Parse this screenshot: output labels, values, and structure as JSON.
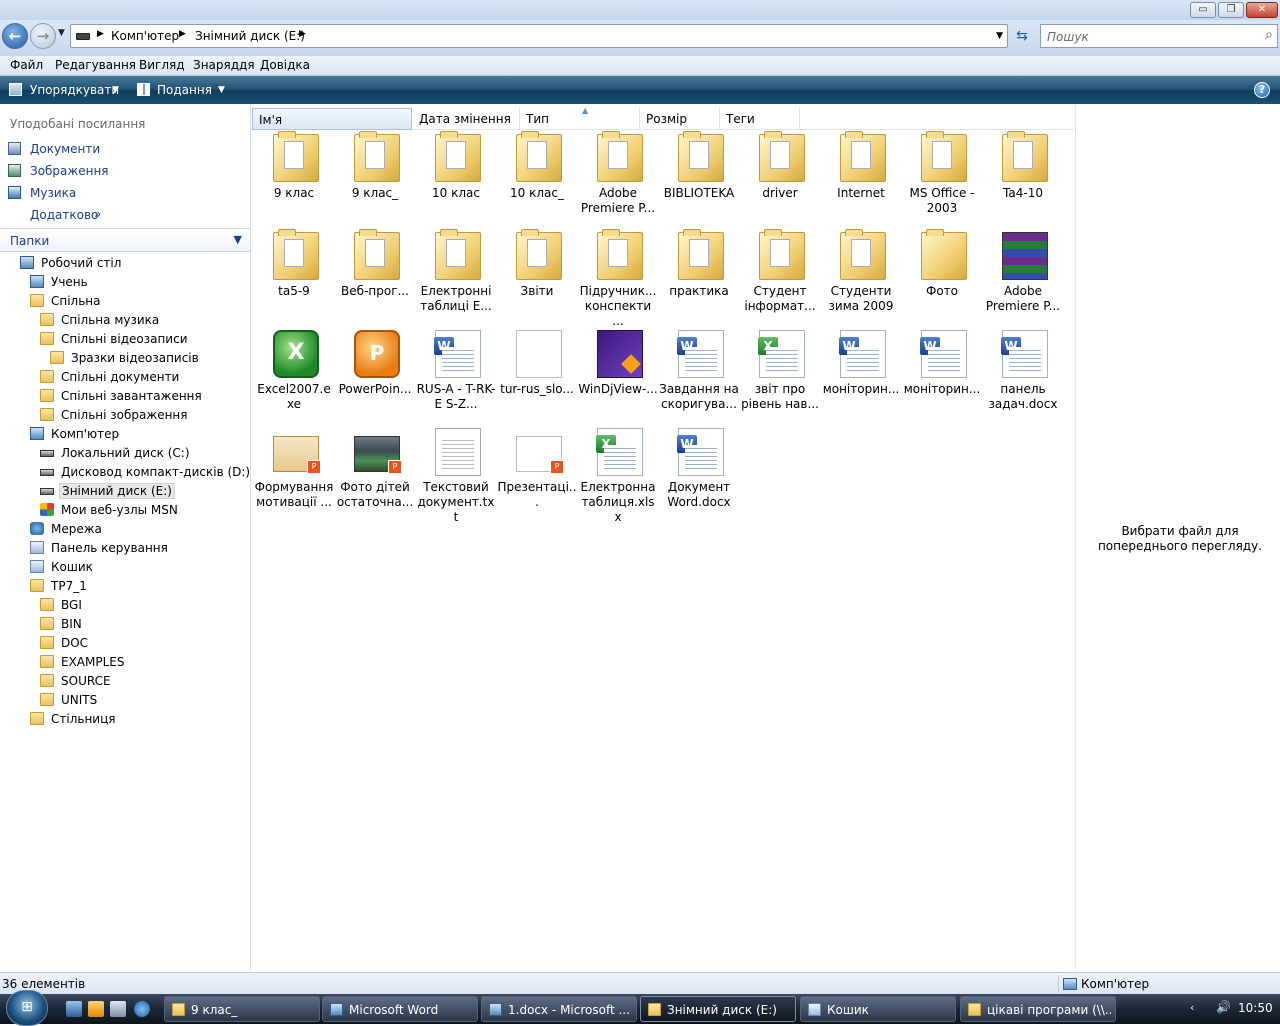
{
  "window": {
    "caption_buttons": {
      "minimize": "▭",
      "maximize": "❐",
      "close": "✕"
    }
  },
  "address": {
    "crumbs": [
      "Комп'ютер",
      "Знімний диск (E:)"
    ],
    "search_placeholder": "Пошук"
  },
  "menu": [
    "Файл",
    "Редагування",
    "Вигляд",
    "Знаряддя",
    "Довідка"
  ],
  "commands": {
    "organize": "Упорядкувати",
    "view": "Подання",
    "help": "?"
  },
  "favorites": {
    "title": "Уподобані посилання",
    "items": [
      "Документи",
      "Зображення",
      "Музика",
      "Додатково"
    ]
  },
  "folders": {
    "title": "Папки",
    "tree": [
      {
        "label": "Робочий стіл",
        "icon": "desktop-icon"
      },
      {
        "label": "Учень",
        "icon": "user-icon"
      },
      {
        "label": "Спільна",
        "icon": "folder-icon"
      },
      {
        "label": "Спільна музика",
        "icon": "folder-icon"
      },
      {
        "label": "Спільні відеозаписи",
        "icon": "folder-icon"
      },
      {
        "label": "Зразки відеозаписів",
        "icon": "folder-icon"
      },
      {
        "label": "Спільні документи",
        "icon": "folder-icon"
      },
      {
        "label": "Спільні завантаження",
        "icon": "folder-icon"
      },
      {
        "label": "Спільні зображення",
        "icon": "folder-icon"
      },
      {
        "label": "Комп'ютер",
        "icon": "computer-icon"
      },
      {
        "label": "Локальний диск (C:)",
        "icon": "drive-icon"
      },
      {
        "label": "Дисковод компакт-дисків (D:)",
        "icon": "cd-drive-icon"
      },
      {
        "label": "Знімний диск (E:)",
        "icon": "removable-drive-icon"
      },
      {
        "label": "Мои веб-узлы MSN",
        "icon": "msn-icon"
      },
      {
        "label": "Мережа",
        "icon": "network-icon"
      },
      {
        "label": "Панель керування",
        "icon": "control-panel-icon"
      },
      {
        "label": "Кошик",
        "icon": "recycle-bin-icon"
      },
      {
        "label": "TP7_1",
        "icon": "folder-icon"
      },
      {
        "label": "BGI",
        "icon": "folder-icon"
      },
      {
        "label": "BIN",
        "icon": "folder-icon"
      },
      {
        "label": "DOC",
        "icon": "folder-icon"
      },
      {
        "label": "EXAMPLES",
        "icon": "folder-icon"
      },
      {
        "label": "SOURCE",
        "icon": "folder-icon"
      },
      {
        "label": "UNITS",
        "icon": "folder-icon"
      },
      {
        "label": "Стільниця",
        "icon": "folder-icon"
      }
    ]
  },
  "columns": [
    "Ім'я",
    "Дата змінення",
    "Тип",
    "Розмір",
    "Теги"
  ],
  "files": [
    {
      "name": "9 клас",
      "type": "folder"
    },
    {
      "name": "9 клас_",
      "type": "folder"
    },
    {
      "name": "10 клас",
      "type": "folder"
    },
    {
      "name": "10 клас_",
      "type": "folder"
    },
    {
      "name": "Adobe Premiere P...",
      "type": "folder"
    },
    {
      "name": "BIBLIOTEKA",
      "type": "folder"
    },
    {
      "name": "driver",
      "type": "folder"
    },
    {
      "name": "Internet",
      "type": "folder"
    },
    {
      "name": "MS Office - 2003",
      "type": "folder"
    },
    {
      "name": "Ta4-10",
      "type": "folder"
    },
    {
      "name": "ta5-9",
      "type": "folder"
    },
    {
      "name": "Веб-прог...",
      "type": "folder"
    },
    {
      "name": "Електронні таблиці Е...",
      "type": "folder"
    },
    {
      "name": "Звіти",
      "type": "folder"
    },
    {
      "name": "Підручник... конспекти ...",
      "type": "folder"
    },
    {
      "name": "практика",
      "type": "folder"
    },
    {
      "name": "Студент інформат...",
      "type": "folder"
    },
    {
      "name": "Студенти зима 2009",
      "type": "folder"
    },
    {
      "name": "Фото",
      "type": "folder-empty"
    },
    {
      "name": "Adobe Premiere P...",
      "type": "rar"
    },
    {
      "name": "Excel2007.exe",
      "type": "excel-exe"
    },
    {
      "name": "PowerPoin...",
      "type": "ppt-exe"
    },
    {
      "name": "RUS-A - T-RK-E S-Z...",
      "type": "word"
    },
    {
      "name": "tur-rus_slo...",
      "type": "blank"
    },
    {
      "name": "WinDjView-...",
      "type": "djvu"
    },
    {
      "name": "Завдання на скоригува...",
      "type": "word"
    },
    {
      "name": "звіт про рівень нав...",
      "type": "excel"
    },
    {
      "name": "моніторин...",
      "type": "word"
    },
    {
      "name": "моніторин...",
      "type": "word"
    },
    {
      "name": "панель задач.docx",
      "type": "word"
    },
    {
      "name": "Формування мотивації ...",
      "type": "pres"
    },
    {
      "name": "Фото дітей остаточна...",
      "type": "photo-pres"
    },
    {
      "name": "Текстовий документ.txt",
      "type": "txt"
    },
    {
      "name": "Презентаці...",
      "type": "blank-pres"
    },
    {
      "name": "Електронна таблиця.xlsx",
      "type": "excel"
    },
    {
      "name": "Документ Word.docx",
      "type": "word"
    }
  ],
  "preview": {
    "text": "Вибрати файл для попереднього перегляду."
  },
  "status": {
    "count": "36 елементів",
    "location": "Комп'ютер"
  },
  "taskbar": {
    "tasks": [
      {
        "label": "9 клас_",
        "active": false
      },
      {
        "label": "Microsoft Word",
        "active": false
      },
      {
        "label": "1.docx - Microsoft ...",
        "active": false
      },
      {
        "label": "Знімний диск (E:)",
        "active": true
      },
      {
        "label": "Кошик",
        "active": false
      },
      {
        "label": "цікаві програми (\\\\...",
        "active": false
      }
    ],
    "clock": "10:50"
  }
}
